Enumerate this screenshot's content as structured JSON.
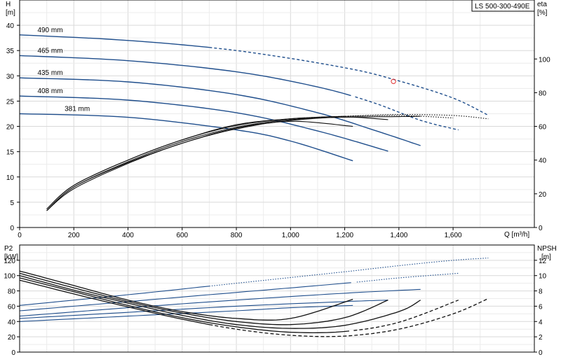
{
  "chart_data": [
    {
      "type": "line",
      "model_label": "LS 500-300-490E",
      "left_axis": {
        "label": "H",
        "unit": "[m]",
        "ylim": [
          0,
          45
        ],
        "ticks": [
          0,
          5,
          10,
          15,
          20,
          25,
          30,
          35,
          40
        ]
      },
      "right_axis": {
        "label": "eta",
        "unit": "[%]",
        "ylim": [
          0,
          135
        ],
        "ticks": [
          0,
          20,
          40,
          60,
          80,
          100
        ]
      },
      "x_axis": {
        "label": "Q [m³/h]",
        "xlim": [
          0,
          1900
        ],
        "ticks": [
          0,
          200,
          400,
          600,
          800,
          1000,
          1200,
          1400,
          1600
        ],
        "tick_labels": [
          "0",
          "200",
          "400",
          "600",
          "800",
          "1,000",
          "1,200",
          "1,400",
          "1,600"
        ]
      },
      "grid": true,
      "head_series": [
        {
          "name": "490 mm",
          "solid_end": 700,
          "points": [
            [
              0,
              38.1
            ],
            [
              400,
              37.0
            ],
            [
              800,
              35.0
            ],
            [
              1200,
              31.6
            ],
            [
              1400,
              29.0
            ],
            [
              1600,
              25.6
            ],
            [
              1730,
              22.2
            ]
          ]
        },
        {
          "name": "465 mm",
          "solid_end": 1230,
          "points": [
            [
              0,
              34.0
            ],
            [
              400,
              33.0
            ],
            [
              800,
              30.8
            ],
            [
              1100,
              27.8
            ],
            [
              1300,
              24.8
            ],
            [
              1480,
              21.2
            ],
            [
              1620,
              19.3
            ]
          ]
        },
        {
          "name": "435 mm",
          "solid_end": 1480,
          "points": [
            [
              0,
              29.6
            ],
            [
              400,
              28.8
            ],
            [
              800,
              26.3
            ],
            [
              1100,
              22.7
            ],
            [
              1300,
              19.4
            ],
            [
              1480,
              16.2
            ]
          ]
        },
        {
          "name": "408 mm",
          "solid_end": 1360,
          "points": [
            [
              0,
              26.0
            ],
            [
              400,
              25.2
            ],
            [
              800,
              22.7
            ],
            [
              1100,
              19.1
            ],
            [
              1360,
              15.1
            ]
          ]
        },
        {
          "name": "381 mm",
          "solid_end": 1230,
          "points": [
            [
              0,
              22.5
            ],
            [
              400,
              21.8
            ],
            [
              800,
              19.3
            ],
            [
              1000,
              17.1
            ],
            [
              1230,
              13.2
            ]
          ]
        }
      ],
      "eta_series": [
        {
          "name": "490 mm",
          "solid_end": 1050,
          "points": [
            [
              100,
              11
            ],
            [
              200,
              25
            ],
            [
              400,
              40
            ],
            [
              600,
              52
            ],
            [
              800,
              61
            ],
            [
              1000,
              64.5
            ],
            [
              1200,
              66
            ],
            [
              1400,
              67
            ],
            [
              1600,
              66.5
            ],
            [
              1730,
              64.5
            ]
          ]
        },
        {
          "name": "465 mm",
          "solid_end": 1200,
          "points": [
            [
              100,
              11
            ],
            [
              200,
              25
            ],
            [
              400,
              40
            ],
            [
              600,
              52
            ],
            [
              800,
              60.5
            ],
            [
              1000,
              64.5
            ],
            [
              1200,
              66
            ],
            [
              1400,
              66.5
            ],
            [
              1600,
              65
            ]
          ]
        },
        {
          "name": "435 mm",
          "solid_end": 1480,
          "points": [
            [
              100,
              10
            ],
            [
              200,
              24
            ],
            [
              400,
              39
            ],
            [
              600,
              51
            ],
            [
              800,
              59.5
            ],
            [
              1000,
              64
            ],
            [
              1200,
              65.5
            ],
            [
              1400,
              65.8
            ],
            [
              1480,
              66
            ]
          ]
        },
        {
          "name": "408 mm",
          "solid_end": 1360,
          "points": [
            [
              100,
              10
            ],
            [
              200,
              24
            ],
            [
              400,
              38.5
            ],
            [
              600,
              50
            ],
            [
              800,
              59
            ],
            [
              1000,
              63.5
            ],
            [
              1200,
              65.5
            ],
            [
              1360,
              64
            ]
          ]
        },
        {
          "name": "381 mm",
          "solid_end": 1230,
          "points": [
            [
              100,
              10
            ],
            [
              200,
              23
            ],
            [
              400,
              38
            ],
            [
              600,
              50
            ],
            [
              800,
              58.5
            ],
            [
              1000,
              63
            ],
            [
              1230,
              60
            ]
          ]
        }
      ],
      "duty_point": {
        "q": 1380,
        "h": 28.9
      }
    },
    {
      "type": "line",
      "left_axis": {
        "label": "P2",
        "unit": "[kW]",
        "ylim": [
          0,
          140
        ],
        "ticks": [
          0,
          20,
          40,
          60,
          80,
          100,
          120
        ]
      },
      "right_axis": {
        "label": "NPSH",
        "unit": "[m]",
        "ylim": [
          0,
          14
        ],
        "ticks": [
          0,
          2,
          4,
          6,
          8,
          10,
          12
        ]
      },
      "x_axis": {
        "xlim": [
          0,
          1900
        ],
        "ticks": [
          0,
          200,
          400,
          600,
          800,
          1000,
          1200,
          1400,
          1600
        ]
      },
      "grid": true,
      "power_series": [
        {
          "name": "490 mm",
          "solid_end": 700,
          "points": [
            [
              0,
              61
            ],
            [
              400,
              75
            ],
            [
              800,
              90
            ],
            [
              1200,
              105
            ],
            [
              1400,
              113
            ],
            [
              1600,
              120
            ],
            [
              1730,
              123
            ]
          ]
        },
        {
          "name": "465 mm",
          "solid_end": 1230,
          "points": [
            [
              0,
              54
            ],
            [
              400,
              66
            ],
            [
              800,
              78
            ],
            [
              1200,
              90
            ],
            [
              1400,
              97
            ],
            [
              1620,
              103
            ]
          ]
        },
        {
          "name": "435 mm",
          "solid_end": 1480,
          "points": [
            [
              0,
              47
            ],
            [
              400,
              58
            ],
            [
              800,
              68
            ],
            [
              1200,
              77
            ],
            [
              1480,
              82
            ]
          ]
        },
        {
          "name": "408 mm",
          "solid_end": 1360,
          "points": [
            [
              0,
              44
            ],
            [
              400,
              52
            ],
            [
              800,
              60
            ],
            [
              1200,
              66
            ],
            [
              1360,
              68
            ]
          ]
        },
        {
          "name": "381 mm",
          "solid_end": 1230,
          "points": [
            [
              0,
              40
            ],
            [
              400,
              47
            ],
            [
              800,
              54
            ],
            [
              1000,
              58
            ],
            [
              1230,
              61
            ]
          ]
        }
      ],
      "npsh_series": [
        {
          "name": "490 mm",
          "solid_end": 700,
          "points": [
            [
              0,
              9.4
            ],
            [
              200,
              7.6
            ],
            [
              400,
              5.9
            ],
            [
              600,
              4.3
            ],
            [
              800,
              3.0
            ],
            [
              1000,
              2.2
            ],
            [
              1200,
              2.1
            ],
            [
              1400,
              3.0
            ],
            [
              1600,
              5.0
            ],
            [
              1730,
              7.0
            ]
          ]
        },
        {
          "name": "465 mm",
          "solid_end": 1230,
          "points": [
            [
              0,
              9.7
            ],
            [
              200,
              7.9
            ],
            [
              400,
              6.1
            ],
            [
              600,
              4.5
            ],
            [
              800,
              3.3
            ],
            [
              1000,
              2.6
            ],
            [
              1200,
              2.7
            ],
            [
              1400,
              3.9
            ],
            [
              1620,
              6.8
            ]
          ]
        },
        {
          "name": "435 mm",
          "solid_end": 1480,
          "points": [
            [
              0,
              10.0
            ],
            [
              200,
              8.1
            ],
            [
              400,
              6.4
            ],
            [
              600,
              4.8
            ],
            [
              800,
              3.6
            ],
            [
              1000,
              3.1
            ],
            [
              1200,
              3.5
            ],
            [
              1400,
              5.3
            ],
            [
              1480,
              6.8
            ]
          ]
        },
        {
          "name": "408 mm",
          "solid_end": 1360,
          "points": [
            [
              0,
              10.3
            ],
            [
              200,
              8.4
            ],
            [
              400,
              6.6
            ],
            [
              600,
              5.1
            ],
            [
              800,
              4.0
            ],
            [
              1000,
              3.6
            ],
            [
              1200,
              4.5
            ],
            [
              1360,
              6.8
            ]
          ]
        },
        {
          "name": "381 mm",
          "solid_end": 1230,
          "points": [
            [
              0,
              10.6
            ],
            [
              200,
              8.7
            ],
            [
              400,
              6.8
            ],
            [
              600,
              5.3
            ],
            [
              800,
              4.4
            ],
            [
              1000,
              4.4
            ],
            [
              1230,
              6.9
            ]
          ]
        }
      ]
    }
  ]
}
